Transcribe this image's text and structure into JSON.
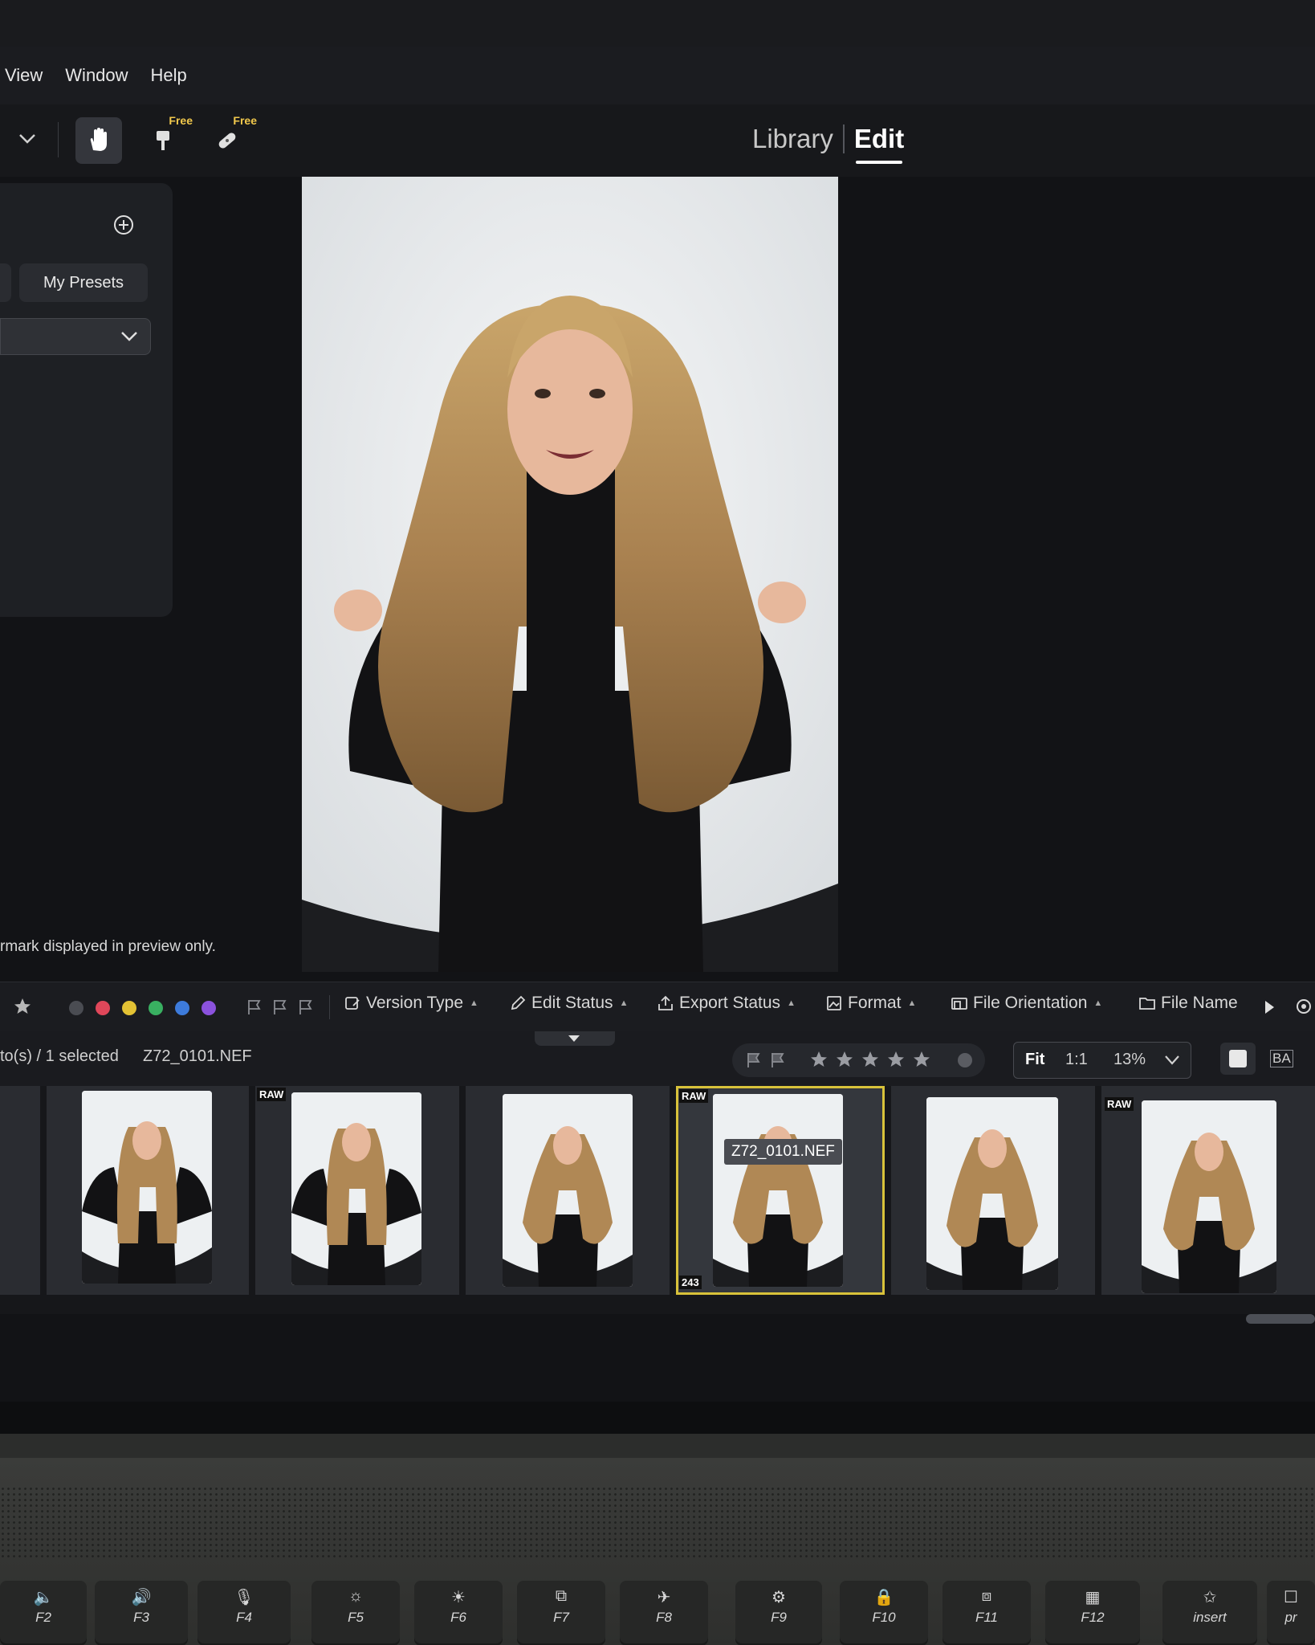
{
  "menu": {
    "items": [
      {
        "label": "View"
      },
      {
        "label": "Window"
      },
      {
        "label": "Help"
      }
    ]
  },
  "toolbar": {
    "tools": [
      {
        "icon": "hand-icon",
        "active": true
      },
      {
        "icon": "brush-icon",
        "badge": "Free"
      },
      {
        "icon": "bandage-icon",
        "badge": "Free"
      }
    ]
  },
  "mode_tabs": [
    {
      "label": "Library",
      "active": false
    },
    {
      "label": "Edit",
      "active": true
    }
  ],
  "presets_panel": {
    "tab_label": "My Presets",
    "add_icon": "plus-circle-icon"
  },
  "preview": {
    "watermark_note": "rmark displayed in preview only."
  },
  "filter_bar": {
    "color_labels": [
      "#4a4c52",
      "#e0475a",
      "#e3c234",
      "#39b061",
      "#3d7bdb",
      "#8b52dd"
    ],
    "filters": [
      {
        "label": "Version Type"
      },
      {
        "label": "Edit Status"
      },
      {
        "label": "Export Status"
      },
      {
        "label": "Format"
      },
      {
        "label": "File Orientation"
      },
      {
        "label": "File Name"
      }
    ]
  },
  "info_bar": {
    "selection": "to(s) / 1 selected",
    "file_name": "Z72_0101.NEF",
    "zoom_fit": "Fit",
    "zoom_1to1": "1:1",
    "zoom_level": "13%",
    "compare_label": "BA"
  },
  "filmstrip": {
    "selected_index": 3,
    "tooltip": "Z72_0101.NEF",
    "raw_badge": "RAW",
    "count_badge": "243",
    "items": [
      {
        "raw": false,
        "pose": "hands-up"
      },
      {
        "raw": true,
        "pose": "hands-up"
      },
      {
        "raw": false,
        "pose": "hair"
      },
      {
        "raw": true,
        "pose": "hair"
      },
      {
        "raw": false,
        "pose": "hair"
      },
      {
        "raw": true,
        "pose": "hair"
      }
    ]
  },
  "keyboard": {
    "keys": [
      {
        "label": "F2",
        "glyph": "🔈"
      },
      {
        "label": "F3",
        "glyph": "🔊"
      },
      {
        "label": "F4",
        "glyph": "🎙"
      },
      {
        "label": "F5",
        "glyph": "☼"
      },
      {
        "label": "F6",
        "glyph": "☀"
      },
      {
        "label": "F7",
        "glyph": "⧉"
      },
      {
        "label": "F8",
        "glyph": "✈"
      },
      {
        "label": "F9",
        "glyph": "⚙"
      },
      {
        "label": "F10",
        "glyph": "🔒"
      },
      {
        "label": "F11",
        "glyph": "⧈"
      },
      {
        "label": "F12",
        "glyph": "▦"
      },
      {
        "label": "insert",
        "glyph": "✩"
      },
      {
        "label": "pr",
        "glyph": "☐"
      }
    ]
  }
}
